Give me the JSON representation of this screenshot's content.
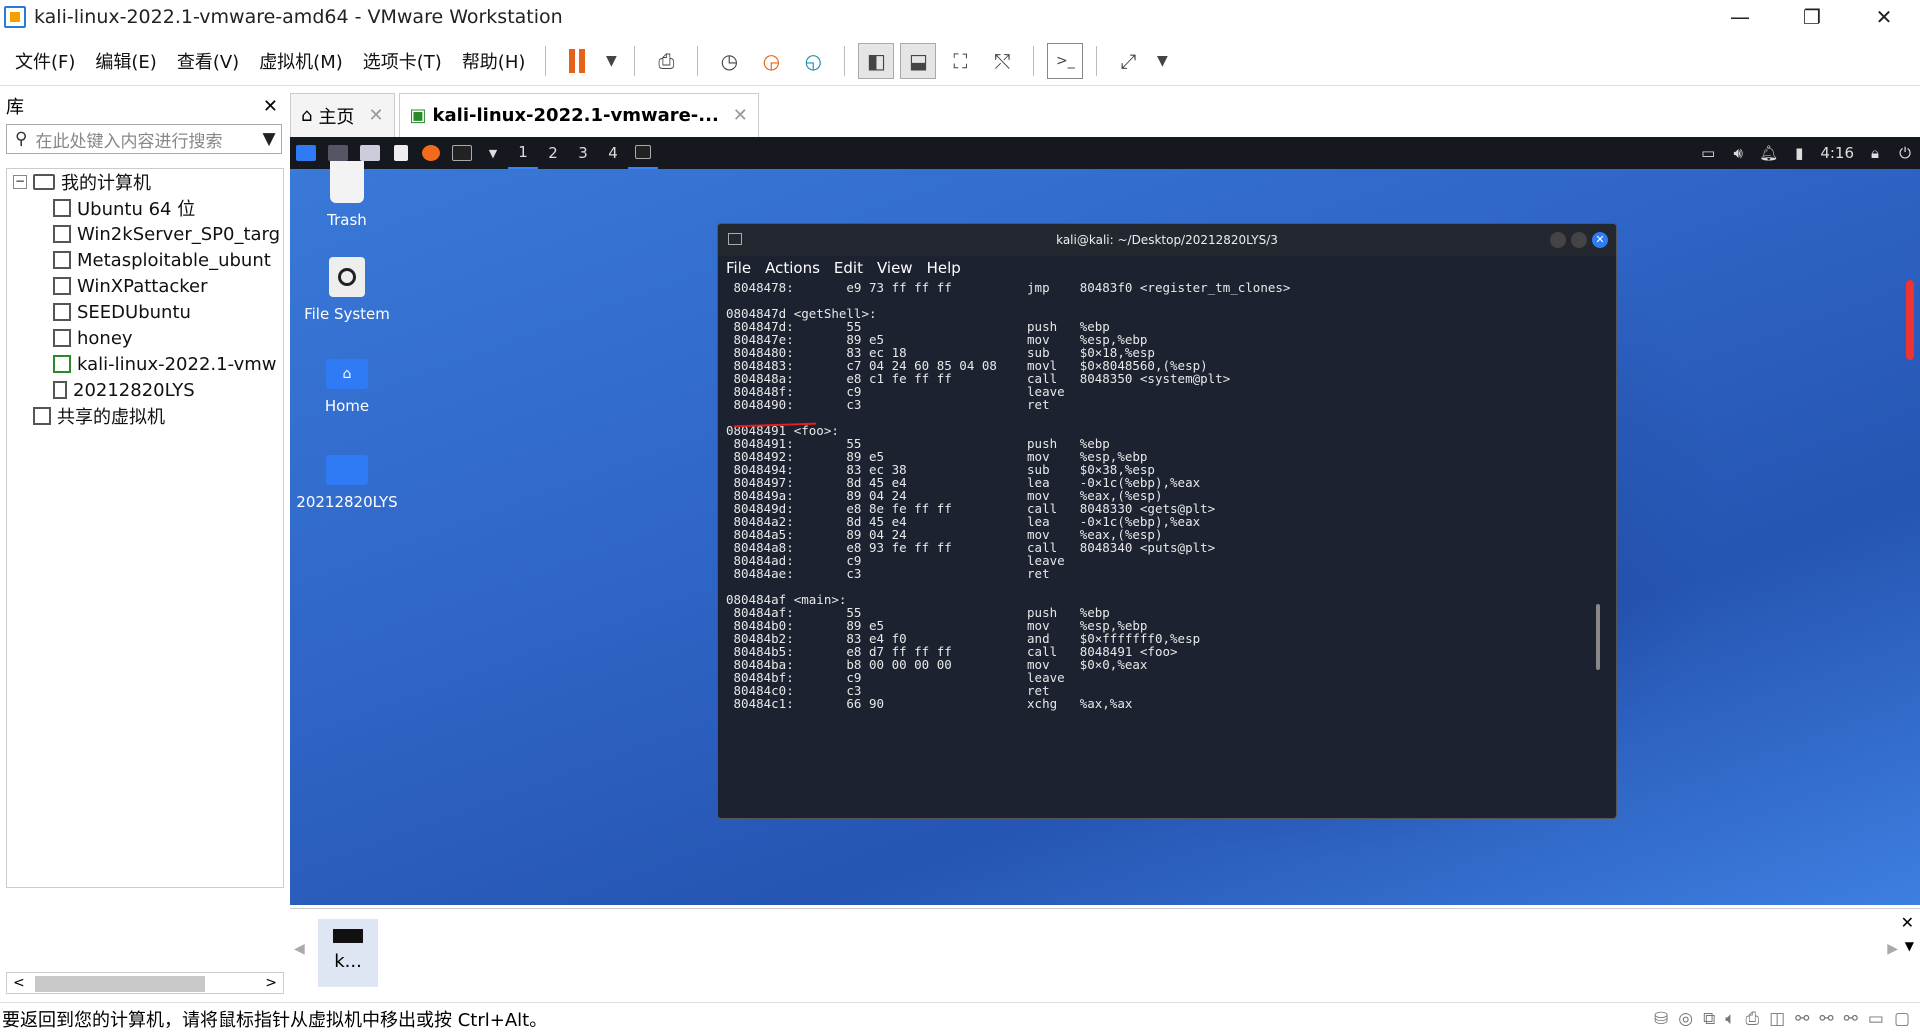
{
  "window": {
    "title": "kali-linux-2022.1-vmware-amd64 - VMware Workstation",
    "min": "—",
    "max": "❐",
    "close": "✕"
  },
  "menu": [
    "文件(F)",
    "编辑(E)",
    "查看(V)",
    "虚拟机(M)",
    "选项卡(T)",
    "帮助(H)"
  ],
  "library": {
    "title": "库",
    "close": "✕",
    "search_placeholder": "在此处键入内容进行搜索",
    "root": "我的计算机",
    "vms": [
      "Ubuntu 64 位",
      "Win2kServer_SP0_targ",
      "Metasploitable_ubunt",
      "WinXPattacker",
      "SEEDUbuntu",
      "honey",
      "kali-linux-2022.1-vmw",
      "20212820LYS"
    ],
    "shared": "共享的虚拟机"
  },
  "tabs": [
    {
      "label": "主页"
    },
    {
      "label": "kali-linux-2022.1-vmware-..."
    }
  ],
  "kali": {
    "workspaces": [
      "1",
      "2",
      "3",
      "4"
    ],
    "clock": "4:16",
    "desktop_icons": [
      "Trash",
      "File System",
      "Home",
      "20212820LYS"
    ],
    "terminal": {
      "title": "kali@kali: ~/Desktop/20212820LYS/3",
      "menu": [
        "File",
        "Actions",
        "Edit",
        "View",
        "Help"
      ],
      "lines": [
        " 8048478:       e9 73 ff ff ff          jmp    80483f0 <register_tm_clones>",
        "",
        "0804847d <getShell>:",
        " 804847d:       55                      push   %ebp",
        " 804847e:       89 e5                   mov    %esp,%ebp",
        " 8048480:       83 ec 18                sub    $0×18,%esp",
        " 8048483:       c7 04 24 60 85 04 08    movl   $0×8048560,(%esp)",
        " 804848a:       e8 c1 fe ff ff          call   8048350 <system@plt>",
        " 804848f:       c9                      leave",
        " 8048490:       c3                      ret",
        "",
        "08048491 <foo>:",
        " 8048491:       55                      push   %ebp",
        " 8048492:       89 e5                   mov    %esp,%ebp",
        " 8048494:       83 ec 38                sub    $0×38,%esp",
        " 8048497:       8d 45 e4                lea    -0×1c(%ebp),%eax",
        " 804849a:       89 04 24                mov    %eax,(%esp)",
        " 804849d:       e8 8e fe ff ff          call   8048330 <gets@plt>",
        " 80484a2:       8d 45 e4                lea    -0×1c(%ebp),%eax",
        " 80484a5:       89 04 24                mov    %eax,(%esp)",
        " 80484a8:       e8 93 fe ff ff          call   8048340 <puts@plt>",
        " 80484ad:       c9                      leave",
        " 80484ae:       c3                      ret",
        "",
        "080484af <main>:",
        " 80484af:       55                      push   %ebp",
        " 80484b0:       89 e5                   mov    %esp,%ebp",
        " 80484b2:       83 e4 f0                and    $0×fffffff0,%esp",
        " 80484b5:       e8 d7 ff ff ff          call   8048491 <foo>",
        " 80484ba:       b8 00 00 00 00          mov    $0×0,%eax",
        " 80484bf:       c9                      leave",
        " 80484c0:       c3                      ret",
        " 80484c1:       66 90                   xchg   %ax,%ax"
      ]
    }
  },
  "thumbnail": {
    "label": "k..."
  },
  "status": "要返回到您的计算机，请将鼠标指针从虚拟机中移出或按 Ctrl+Alt。"
}
